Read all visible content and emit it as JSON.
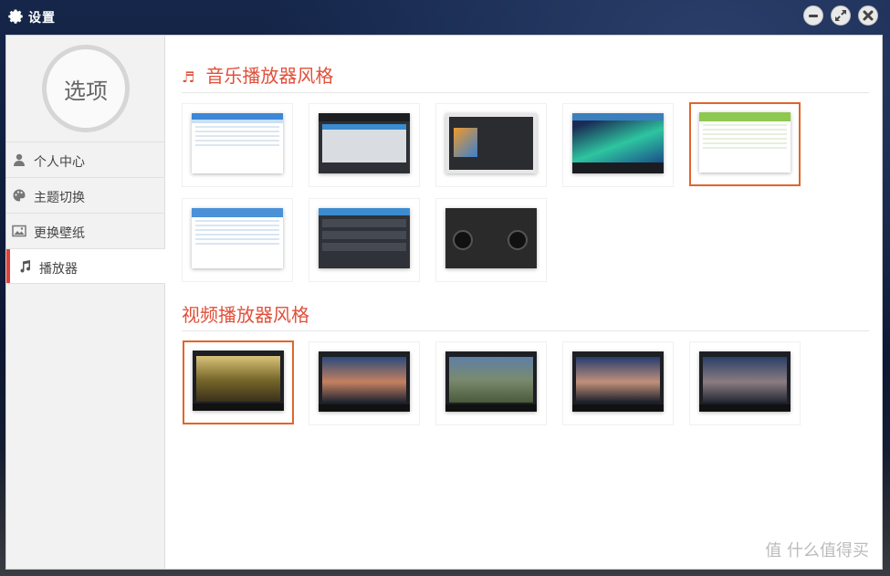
{
  "window": {
    "title": "设置",
    "icons": {
      "settings": "gear-icon",
      "minimize": "minimize-icon",
      "maximize": "maximize-icon",
      "close": "close-icon"
    }
  },
  "sidebar": {
    "avatar_label": "选项",
    "items": [
      {
        "label": "个人中心",
        "icon": "user-icon",
        "active": false
      },
      {
        "label": "主题切换",
        "icon": "palette-icon",
        "active": false
      },
      {
        "label": "更换壁纸",
        "icon": "image-icon",
        "active": false
      },
      {
        "label": "播放器",
        "icon": "music-note-icon",
        "active": true
      }
    ]
  },
  "music_section": {
    "title": "音乐播放器风格",
    "icon": "music-note-icon",
    "skins": [
      {
        "name": "music-skin-1",
        "selected": false
      },
      {
        "name": "music-skin-2",
        "selected": false
      },
      {
        "name": "music-skin-3",
        "selected": false
      },
      {
        "name": "music-skin-4",
        "selected": false
      },
      {
        "name": "music-skin-5",
        "selected": true
      },
      {
        "name": "music-skin-6",
        "selected": false
      },
      {
        "name": "music-skin-7",
        "selected": false
      },
      {
        "name": "music-skin-8",
        "selected": false
      }
    ]
  },
  "video_section": {
    "title": "视频播放器风格",
    "skins": [
      {
        "name": "video-skin-1",
        "selected": true
      },
      {
        "name": "video-skin-2",
        "selected": false
      },
      {
        "name": "video-skin-3",
        "selected": false
      },
      {
        "name": "video-skin-4",
        "selected": false
      },
      {
        "name": "video-skin-5",
        "selected": false
      }
    ]
  },
  "watermark": "值 什么值得买",
  "colors": {
    "accent": "#e0503a",
    "selection": "#e0652a",
    "active_bar": "#e0403a"
  }
}
